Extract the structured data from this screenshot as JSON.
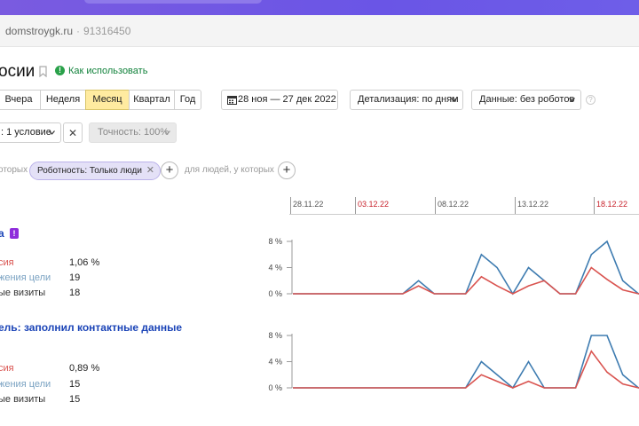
{
  "site": {
    "name": "domstroygk.ru",
    "separator": "·",
    "counter_id": "91316450"
  },
  "page": {
    "title": "осии",
    "help_icon": "!",
    "help_link": "Как использовать"
  },
  "periods": [
    {
      "label": "Вчера",
      "active": false
    },
    {
      "label": "Неделя",
      "active": false
    },
    {
      "label": "Месяц",
      "active": true
    },
    {
      "label": "Квартал",
      "active": false
    },
    {
      "label": "Год",
      "active": false
    }
  ],
  "date_range": "28 ноя — 27 дек 2022",
  "detail_dropdown": "Детализация: по дням",
  "data_dropdown": "Данные: без роботов",
  "help_q": "?",
  "conditions_button": ": 1 условие",
  "close_glyph": "✕",
  "accuracy_button": "Точность: 100%",
  "segment": {
    "prefix": "оторых",
    "chip": "Роботность: Только люди",
    "chip_close": "✕",
    "plus": "+",
    "suffix": "для людей, у которых"
  },
  "date_axis": [
    {
      "label": "28.11.22",
      "weekend": false
    },
    {
      "label": "03.12.22",
      "weekend": true
    },
    {
      "label": "08.12.22",
      "weekend": false
    },
    {
      "label": "13.12.22",
      "weekend": false
    },
    {
      "label": "18.12.22",
      "weekend": true
    }
  ],
  "colors": {
    "conversion": "#d9534f",
    "reaches": "#3d7bb0",
    "accent": "#ffeba0",
    "badge": "#8e2bdb"
  },
  "goals": [
    {
      "title": "а",
      "badge": "!",
      "metrics": [
        {
          "name": "сия",
          "value": "1,06 %"
        },
        {
          "name": "жения цели",
          "value": "19"
        },
        {
          "name": "ые визиты",
          "value": "18"
        }
      ]
    },
    {
      "title": "ель: заполнил контактные данные",
      "badge": "",
      "metrics": [
        {
          "name": "сия",
          "value": "0,89 %"
        },
        {
          "name": "жения цели",
          "value": "15"
        },
        {
          "name": "ые визиты",
          "value": "15"
        }
      ]
    }
  ],
  "chart_data": [
    {
      "type": "line",
      "x": [
        "28.11",
        "29.11",
        "30.11",
        "01.12",
        "02.12",
        "03.12",
        "04.12",
        "05.12",
        "06.12",
        "07.12",
        "08.12",
        "09.12",
        "10.12",
        "11.12",
        "12.12",
        "13.12",
        "14.12",
        "15.12",
        "16.12",
        "17.12",
        "18.12",
        "19.12",
        "20.12",
        "21.12"
      ],
      "yticks": [
        "8 %",
        "4 %",
        "0 %"
      ],
      "ylim": [
        0,
        8
      ],
      "series": [
        {
          "color": "#3d7bb0",
          "values": [
            0,
            0,
            0,
            0,
            0,
            0,
            0,
            0,
            2,
            0,
            0,
            0,
            6,
            4,
            0,
            4,
            2,
            0,
            0,
            6,
            8,
            2,
            0,
            0
          ]
        },
        {
          "color": "#d9534f",
          "values": [
            0,
            0,
            0,
            0,
            0,
            0,
            0,
            0,
            1.2,
            0,
            0,
            0,
            2.6,
            1.2,
            0,
            1.2,
            2,
            0,
            0,
            4,
            2.2,
            0.6,
            0,
            0
          ]
        }
      ]
    },
    {
      "type": "line",
      "x": [
        "28.11",
        "29.11",
        "30.11",
        "01.12",
        "02.12",
        "03.12",
        "04.12",
        "05.12",
        "06.12",
        "07.12",
        "08.12",
        "09.12",
        "10.12",
        "11.12",
        "12.12",
        "13.12",
        "14.12",
        "15.12",
        "16.12",
        "17.12",
        "18.12",
        "19.12",
        "20.12",
        "21.12"
      ],
      "yticks": [
        "8 %",
        "4 %",
        "0 %"
      ],
      "ylim": [
        0,
        8
      ],
      "series": [
        {
          "color": "#3d7bb0",
          "values": [
            0,
            0,
            0,
            0,
            0,
            0,
            0,
            0,
            0,
            0,
            0,
            0,
            4,
            2,
            0,
            4,
            0,
            0,
            0,
            8,
            8,
            2,
            0,
            0
          ]
        },
        {
          "color": "#d9534f",
          "values": [
            0,
            0,
            0,
            0,
            0,
            0,
            0,
            0,
            0,
            0,
            0,
            0,
            2,
            1,
            0,
            1,
            0,
            0,
            0,
            5.6,
            2.4,
            0.6,
            0,
            0
          ]
        }
      ]
    }
  ]
}
